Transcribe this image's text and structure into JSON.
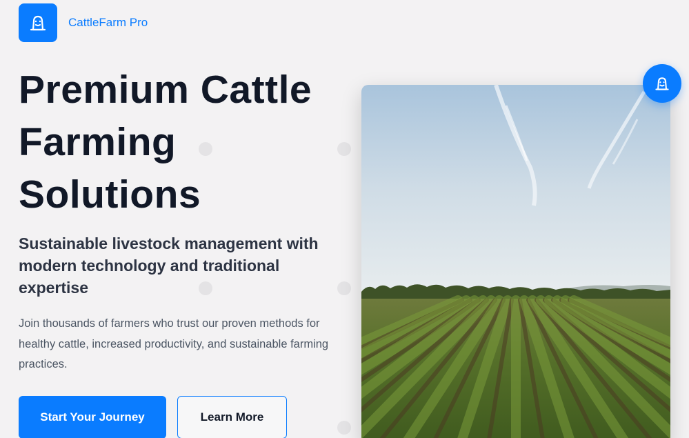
{
  "brand": {
    "name": "CattleFarm Pro",
    "logo_icon": "cow-icon"
  },
  "hero": {
    "title": "Premium Cattle Farming Solutions",
    "subtitle": "Sustainable livestock management with modern technology and traditional expertise",
    "description": "Join thousands of farmers who trust our proven methods for healthy cattle, increased productivity, and sustainable farming practices."
  },
  "buttons": {
    "primary_label": "Start Your Journey",
    "secondary_label": "Learn More"
  },
  "image": {
    "subject": "farm-field-photo"
  },
  "badge": {
    "icon": "cow-icon"
  },
  "colors": {
    "accent": "#0a7cff",
    "background": "#f3f2f3",
    "heading": "#111827",
    "body_text": "#4b5563"
  }
}
